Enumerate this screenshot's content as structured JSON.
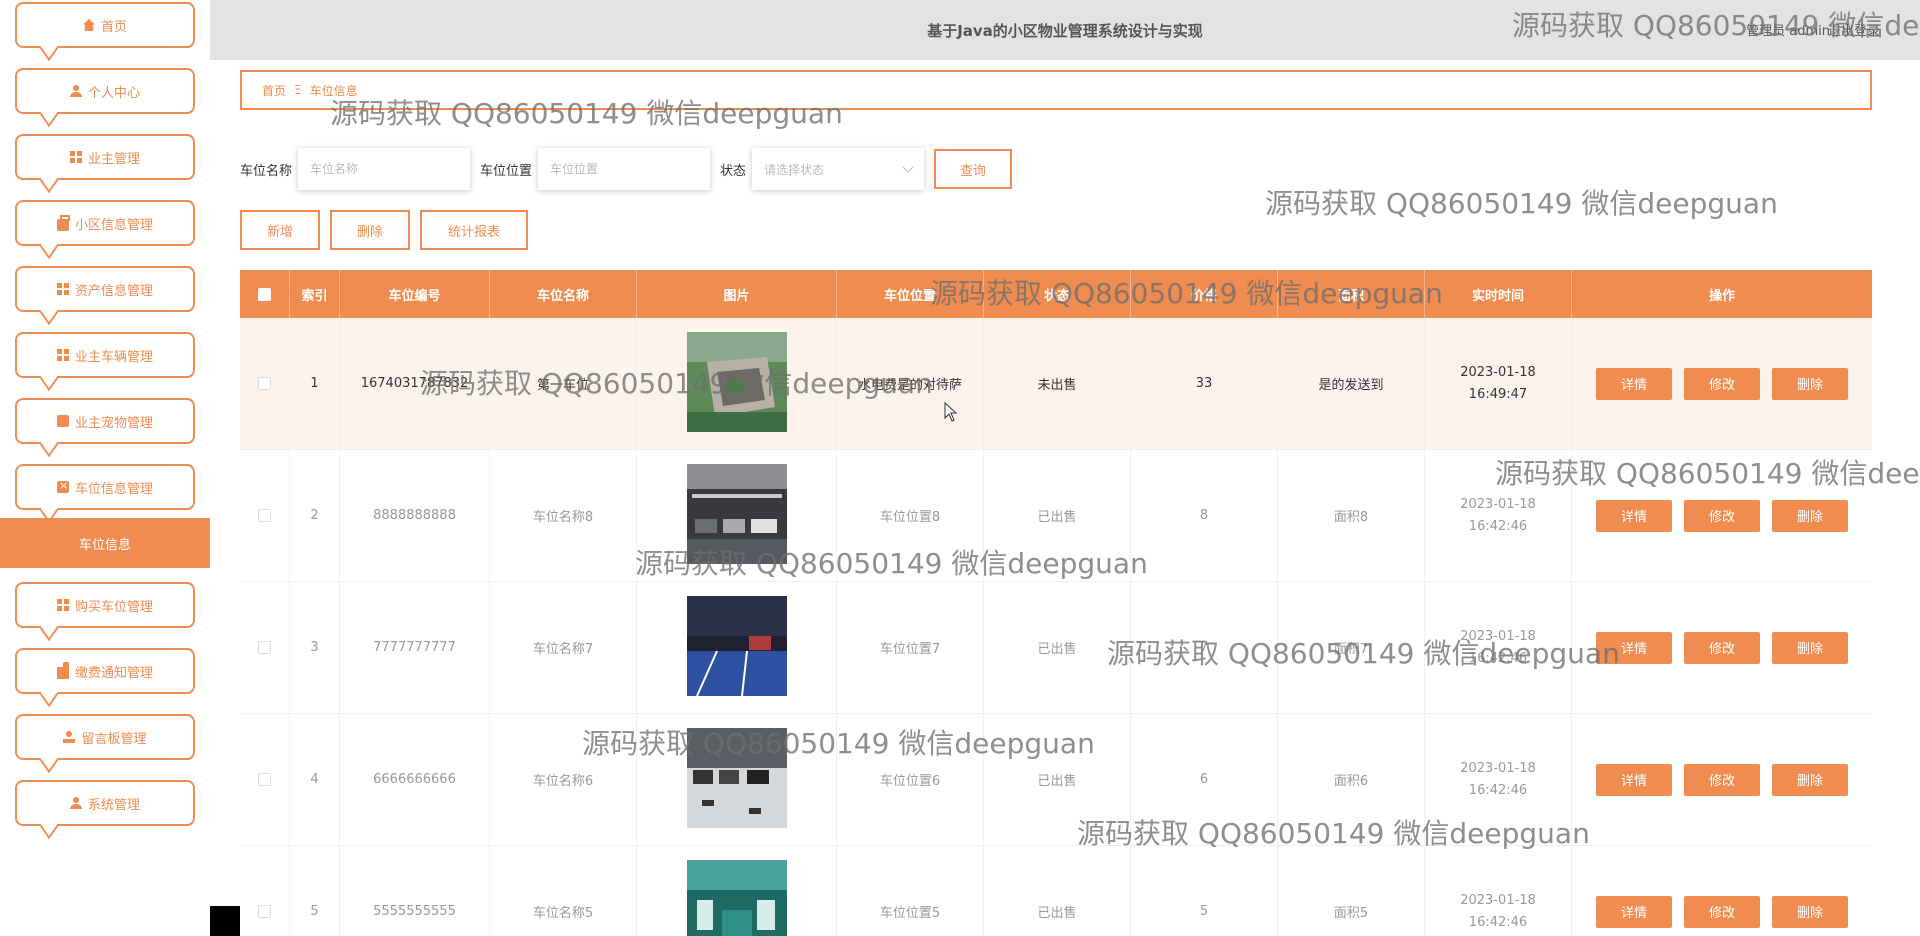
{
  "header": {
    "title": "基于Java的小区物业管理系统设计与实现",
    "user": "管理员 admin",
    "logout": "退出登录"
  },
  "sidebar": {
    "items": [
      {
        "label": "首页",
        "icon": "home-icon"
      },
      {
        "label": "个人中心",
        "icon": "user-icon"
      },
      {
        "label": "业主管理",
        "icon": "grid-icon"
      },
      {
        "label": "小区信息管理",
        "icon": "briefcase-icon"
      },
      {
        "label": "资产信息管理",
        "icon": "grid-icon"
      },
      {
        "label": "业主车辆管理",
        "icon": "grid-icon"
      },
      {
        "label": "业主宠物管理",
        "icon": "pet-icon"
      },
      {
        "label": "车位信息管理",
        "icon": "clipboard-icon"
      },
      {
        "label": "购买车位管理",
        "icon": "grid-icon"
      },
      {
        "label": "缴费通知管理",
        "icon": "money-icon"
      },
      {
        "label": "留言板管理",
        "icon": "board-icon"
      },
      {
        "label": "系统管理",
        "icon": "user-icon"
      }
    ],
    "active_sub": "车位信息"
  },
  "breadcrumb": {
    "home": "首页",
    "separator": "Ξ",
    "current": "车位信息"
  },
  "search": {
    "name_label": "车位名称",
    "name_placeholder": "车位名称",
    "location_label": "车位位置",
    "location_placeholder": "车位位置",
    "status_label": "状态",
    "status_placeholder": "请选择状态",
    "query": "查询"
  },
  "actions": {
    "add": "新增",
    "delete": "删除",
    "report": "统计报表"
  },
  "table": {
    "headers": [
      "索引",
      "车位编号",
      "车位名称",
      "图片",
      "车位位置",
      "状态",
      "价格",
      "面积",
      "实时时间",
      "操作"
    ],
    "rows": [
      {
        "idx": "1",
        "code": "1674031787832",
        "name": "第一车位",
        "loc": "水电费是的对待萨",
        "status": "未出售",
        "price": "33",
        "area": "是的发送到",
        "time": "2023-01-18 16:49:47",
        "img": "aerial"
      },
      {
        "idx": "2",
        "code": "8888888888",
        "name": "车位名称8",
        "loc": "车位位置8",
        "status": "已出售",
        "price": "8",
        "area": "面积8",
        "time": "2023-01-18 16:42:46",
        "img": "garage"
      },
      {
        "idx": "3",
        "code": "7777777777",
        "name": "车位名称7",
        "loc": "车位位置7",
        "status": "已出售",
        "price": "7",
        "area": "面积7",
        "time": "2023-01-18 16:42:46",
        "img": "blue"
      },
      {
        "idx": "4",
        "code": "6666666666",
        "name": "车位名称6",
        "loc": "车位位置6",
        "status": "已出售",
        "price": "6",
        "area": "面积6",
        "time": "2023-01-18 16:42:46",
        "img": "parking"
      },
      {
        "idx": "5",
        "code": "5555555555",
        "name": "车位名称5",
        "loc": "车位位置5",
        "status": "已出售",
        "price": "5",
        "area": "面积5",
        "time": "2023-01-18 16:42:46",
        "img": "green"
      }
    ],
    "ops": [
      "详情",
      "修改",
      "删除"
    ]
  },
  "watermark": "源码获取 QQ86050149 微信deepguan",
  "colors": {
    "accent": "#f08c50",
    "header_bg": "#e3e3e3",
    "row_highlight": "#fdf3ed"
  }
}
